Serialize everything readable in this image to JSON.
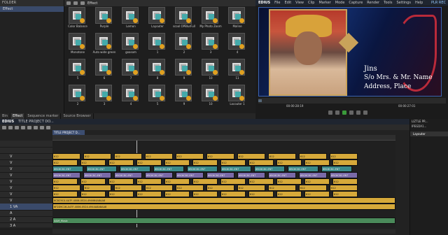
{
  "folder": {
    "title": "FOLDER",
    "items": [
      "Effect"
    ]
  },
  "effects": {
    "title": "Effect",
    "items": [
      {
        "label": "Color Balance"
      },
      {
        "label": "Purple"
      },
      {
        "label": "Lemon"
      },
      {
        "label": "Layouter"
      },
      {
        "label": "scool OPBlurFull"
      },
      {
        "label": "My Photo Zoom"
      },
      {
        "label": "Maline"
      },
      {
        "label": "Monotone"
      },
      {
        "label": "Auto wide green"
      },
      {
        "label": "goasom"
      },
      {
        "label": "1"
      },
      {
        "label": "2"
      },
      {
        "label": "3"
      },
      {
        "label": "4"
      },
      {
        "label": "5"
      },
      {
        "label": "6"
      },
      {
        "label": "7"
      },
      {
        "label": "8"
      },
      {
        "label": "9"
      },
      {
        "label": "10"
      },
      {
        "label": "11"
      },
      {
        "label": "2"
      },
      {
        "label": "3"
      },
      {
        "label": "4"
      },
      {
        "label": "5"
      },
      {
        "label": "9"
      },
      {
        "label": "10"
      },
      {
        "label": "Lacouter 1"
      }
    ]
  },
  "tabs": [
    "Bin",
    "Effect",
    "Sequence marker",
    "Source Browser"
  ],
  "preview": {
    "menu": [
      "EDIUS",
      "File",
      "Edit",
      "View",
      "Clip",
      "Marker",
      "Mode",
      "Capture",
      "Render",
      "Tools",
      "Settings",
      "Help"
    ],
    "mode": "PLR REC",
    "overlay": {
      "name": "Jins",
      "sub": "S/o Mrs. & Mr. Name",
      "addr": "Address, Place"
    },
    "tc_in": "00:00:28:19",
    "tc_out": "00:00:27:01",
    "progress": 0.02
  },
  "timeline": {
    "menu": [
      "EDIUS",
      "TITLE PROJECT DO..."
    ],
    "sequence": "TITLE PROJECT D...",
    "tracks": [
      "",
      "",
      "V",
      "V",
      "V",
      "V",
      "V",
      "V",
      "V",
      "V",
      "1 VA",
      "A",
      "2 A",
      "3 A"
    ],
    "clip_labels": {
      "gold": "612",
      "purple": "6BC6C8C.ENT",
      "row_a": "6C8C9C4-4A7F-4006-0524-494664A8AA8",
      "row_b": "6F2D9C16-A47F-4006-0524-4944A8A8AA8",
      "music": "A&M_Music"
    }
  },
  "info": {
    "file_name": "LIZTLE PR...",
    "clip_name": "IPEGDA1...",
    "layer_item": "Layouter"
  }
}
